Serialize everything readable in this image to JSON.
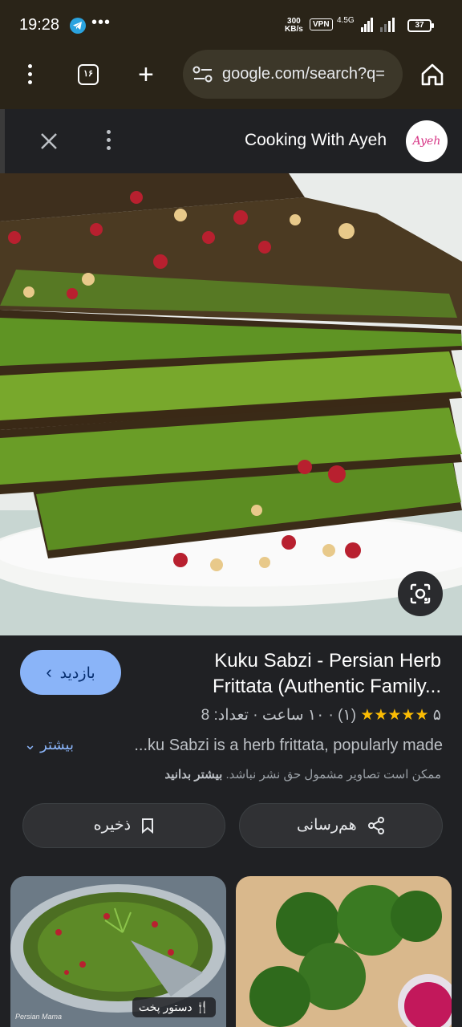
{
  "status_bar": {
    "time": "19:28",
    "net_speed_value": "300",
    "net_speed_unit": "KB/s",
    "vpn": "VPN",
    "network_type": "4.5G",
    "battery": "37"
  },
  "browser": {
    "tab_count": "۱۶",
    "url": "google.com/search?q="
  },
  "panel": {
    "source_name": "Cooking With Ayeh",
    "source_logo_text": "Ayeh"
  },
  "result": {
    "visit_label": "بازدید",
    "title": "Kuku Sabzi - Persian Herb Frittata (Authentic Family...",
    "rating_value": "۵",
    "rating_count": "(۱)",
    "duration": "۱۰ ساعت",
    "servings": "تعداد: 8",
    "snippet": "...ku Sabzi is a herb frittata, popularly made",
    "more_label": "بیشتر",
    "copyright_text": "ممکن است تصاویر مشمول حق نشر نباشد.",
    "copyright_link": "بیشتر بدانید",
    "share_label": "هم‌رسانی",
    "save_label": "ذخیره"
  },
  "related": [
    {
      "badge": "دستور پخت",
      "watermark": "Persian Mama"
    },
    {
      "badge": "",
      "watermark": ""
    }
  ],
  "colors": {
    "accent": "#8ab4f8",
    "star": "#fbbc04",
    "background": "#202124",
    "browser_bar": "#2a2418"
  }
}
